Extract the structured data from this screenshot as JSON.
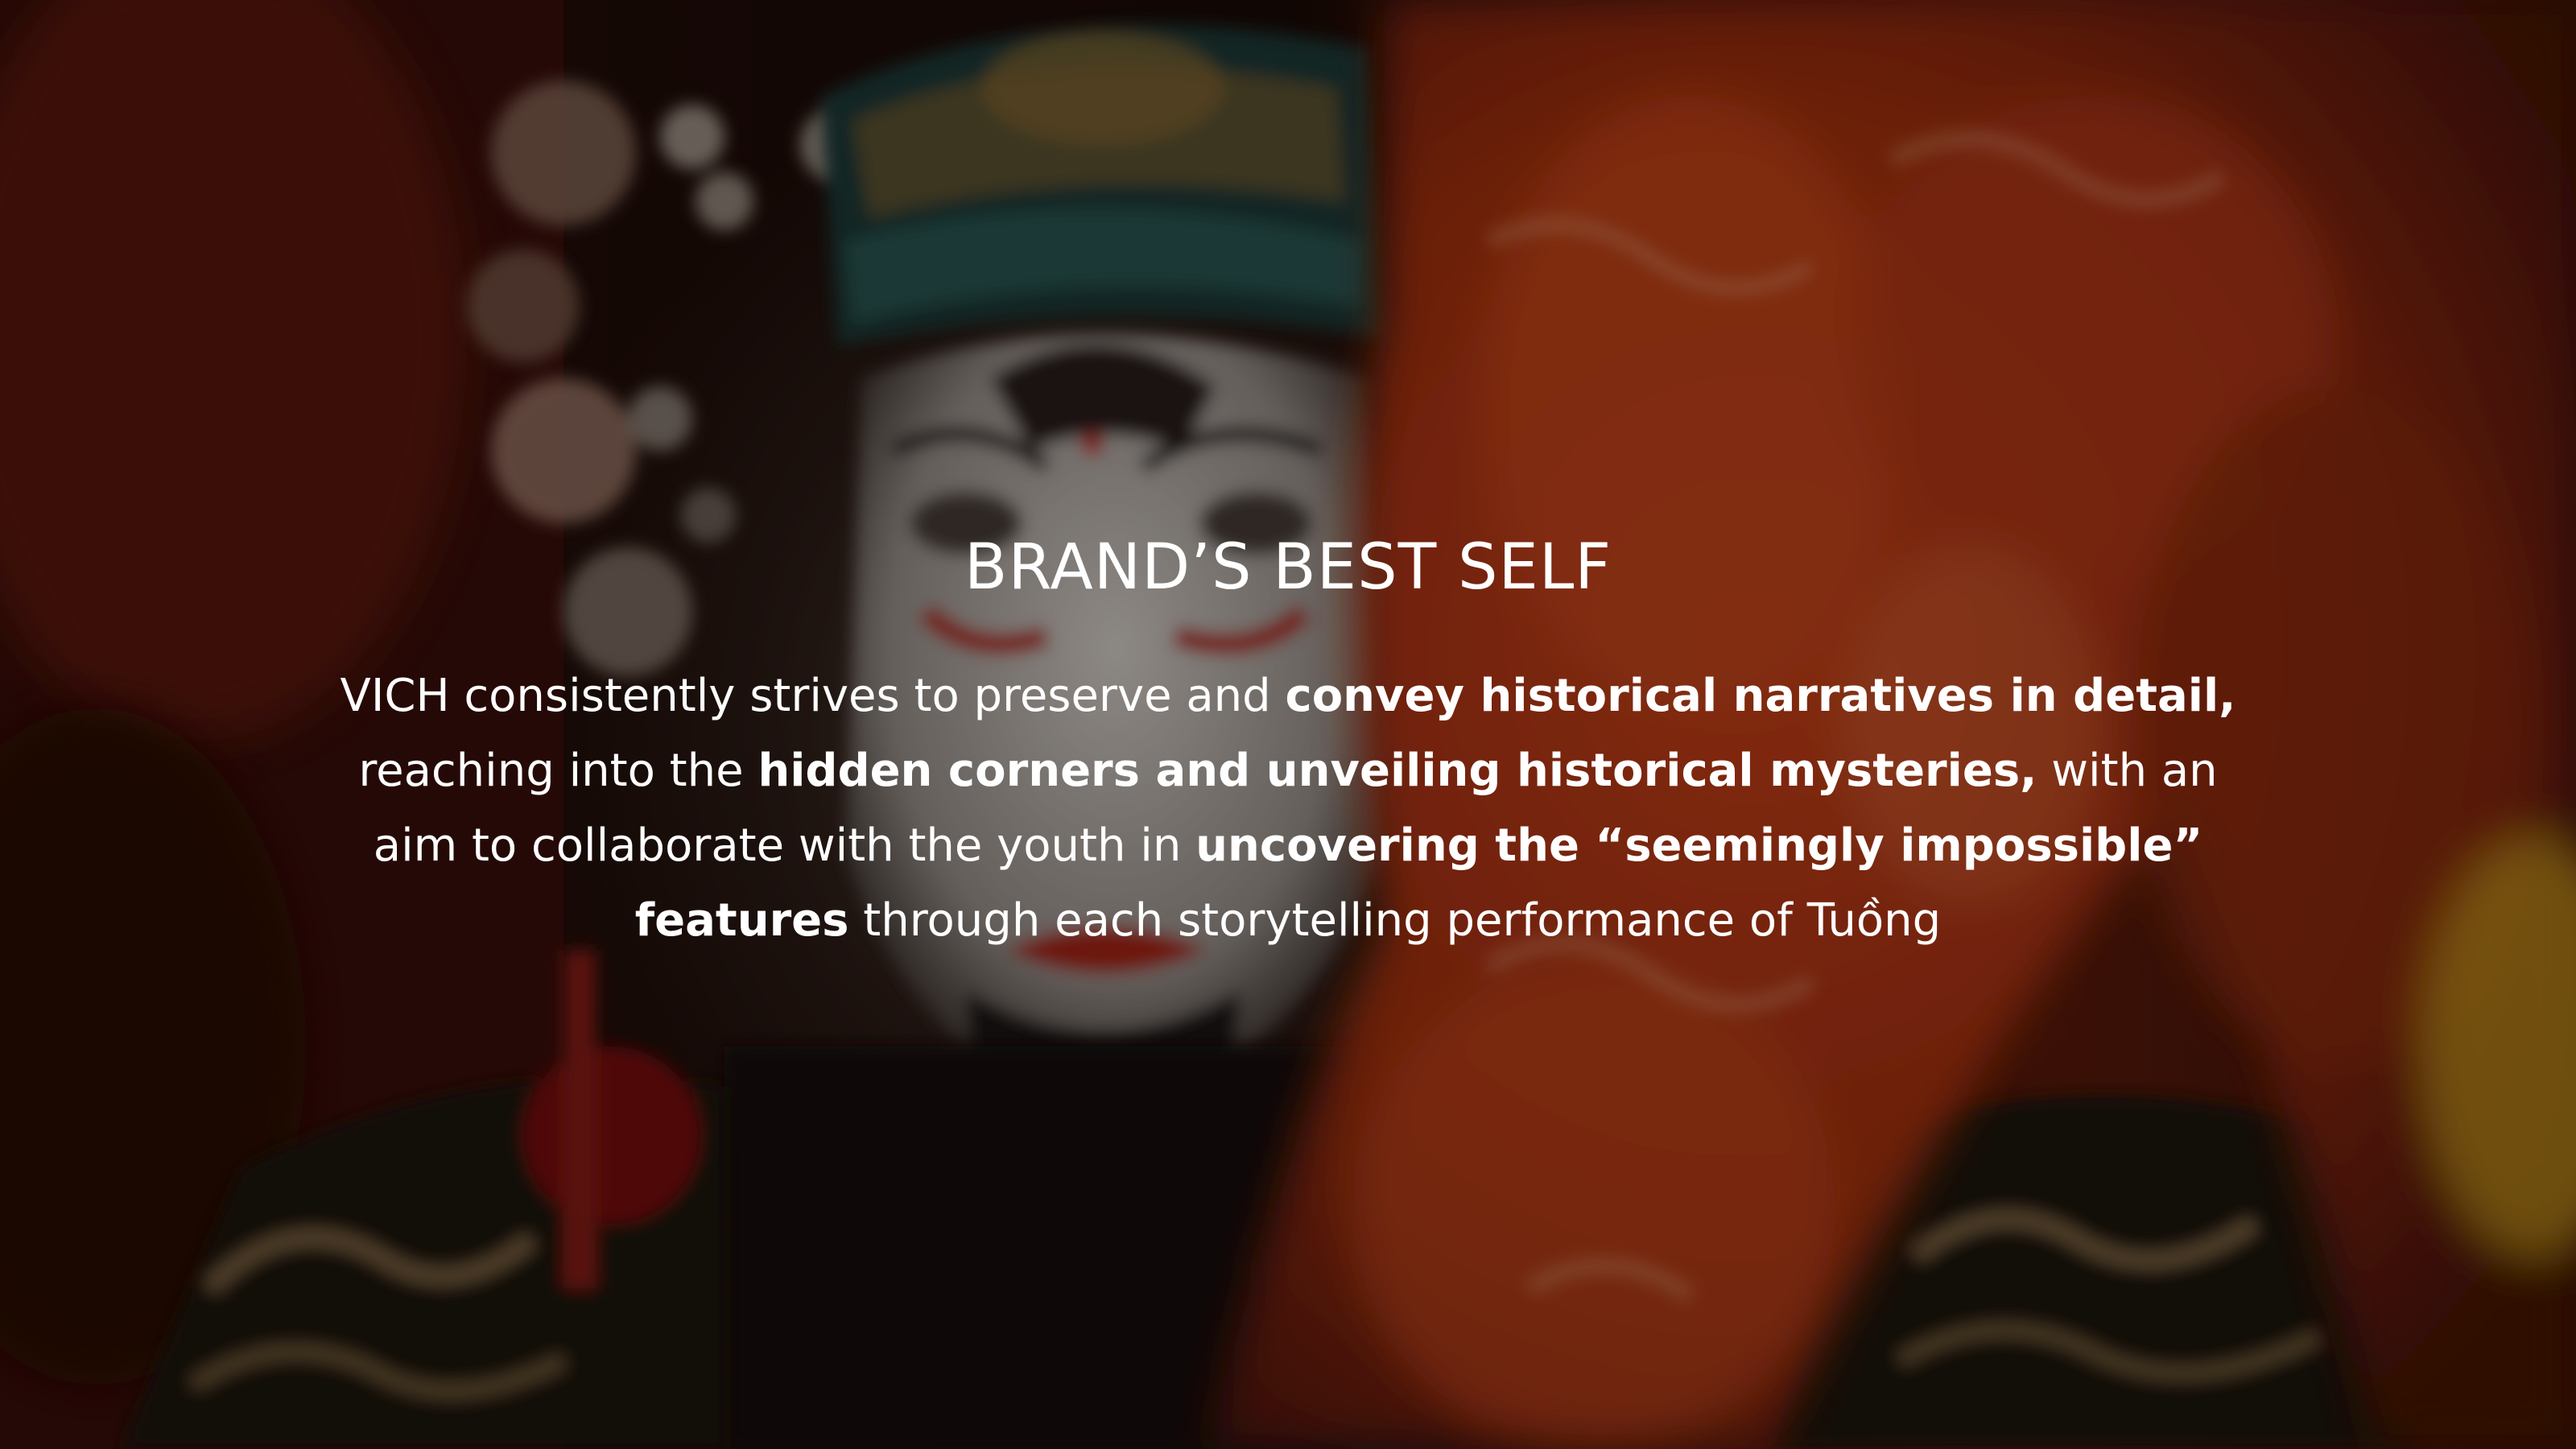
{
  "slide": {
    "title": "BRAND’S BEST SELF",
    "body": [
      {
        "text": "VICH consistently strives to preserve and ",
        "bold": false
      },
      {
        "text": "convey historical narratives in detail,",
        "bold": true
      },
      {
        "text": " reaching into the ",
        "bold": false
      },
      {
        "text": "hidden corners and unveiling historical mysteries,",
        "bold": true
      },
      {
        "text": " with an aim to collaborate with the youth in ",
        "bold": false
      },
      {
        "text": "uncovering the “seemingly impossible” features",
        "bold": true
      },
      {
        "text": " through each storytelling performance of Tuồng",
        "bold": false
      }
    ]
  },
  "background": {
    "subject": "tuong-performer-mask-photo",
    "colors": {
      "dark_base": "#140806",
      "mask_white": "#e9e2dc",
      "fabric_red": "#b8320f",
      "gold": "#8a6a3a",
      "teal": "#1f4a48"
    }
  }
}
